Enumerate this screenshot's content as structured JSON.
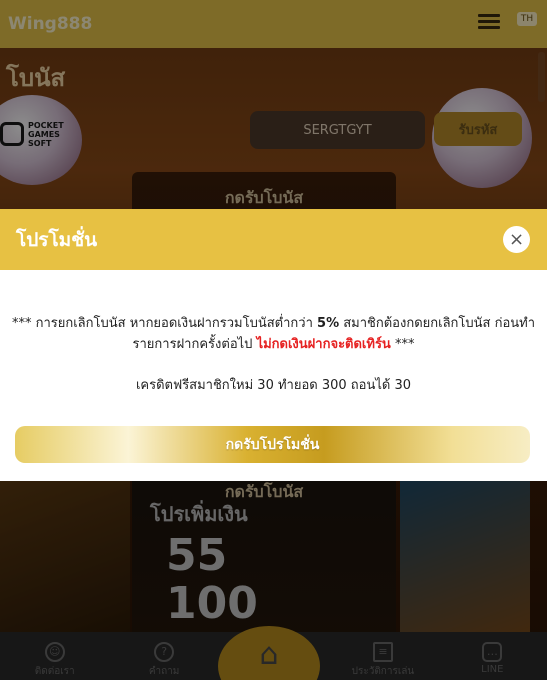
{
  "app": {
    "logo_text": "Wing888",
    "lang_badge": "TH"
  },
  "page": {
    "title": "โบนัส"
  },
  "background": {
    "provider_logo": [
      "POCKET",
      "GAMES",
      "SOFT"
    ],
    "code_value": "SERGTGYT",
    "accept_label": "รับรหัส",
    "card_button_top": "กดรับโบนัส",
    "card_button_bottom": "กดรับโบนัส",
    "card_promo": "โปรเพิ่มเงิน",
    "card_amount_a": "55",
    "card_amount_b": "100"
  },
  "nav": {
    "items": [
      {
        "label": "ติดต่อเรา",
        "icon": "support-icon"
      },
      {
        "label": "คำถาม",
        "icon": "question-icon"
      },
      {
        "label": "",
        "icon": "home-icon"
      },
      {
        "label": "ประวัติการเล่น",
        "icon": "history-icon"
      },
      {
        "label": "LINE",
        "icon": "chat-icon"
      }
    ]
  },
  "modal": {
    "title": "โปรโมชั่น",
    "close_symbol": "×",
    "notice_prefix": "*** การยกเลิกโบนัส หากยอดเงินฝากรวมโบนัสต่ำกว่า ",
    "notice_percent": "5%",
    "notice_middle": " สมาชิกต้องกดยกเลิกโบนัส ก่อนทำรายการฝากครั้งต่อไป ",
    "notice_warning": "ไม่กดเงินฝากจะติดเทิร์น",
    "notice_suffix": " ***",
    "credit_text": "เครดิตฟรีสมาชิกใหม่ 30 ทำยอด 300 ถอนได้ 30",
    "claim_label": "กดรับโปรโมชั่น"
  },
  "colors": {
    "header_yellow": "#e7c143",
    "warning_red": "#e62222",
    "nav_background": "#2a2a2a"
  }
}
